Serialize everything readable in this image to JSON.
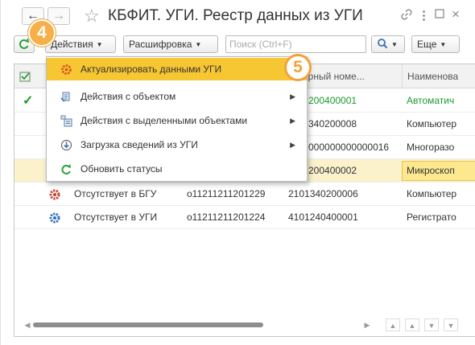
{
  "window": {
    "title": "КБФИТ. УГИ. Реестр данных из УГИ",
    "back_icon": "arrow-left-icon",
    "forward_icon": "arrow-right-icon",
    "favorite_icon": "star-icon",
    "link_icon": "link-icon",
    "more_icon": "more-vertical-icon",
    "maximize_icon": "maximize-icon",
    "close_icon": "close-icon"
  },
  "toolbar": {
    "refresh_icon": "refresh-icon",
    "actions_label": "Действия",
    "decode_label": "Расшифровка",
    "search_placeholder": "Поиск (Ctrl+F)",
    "search_icon": "magnifier-icon",
    "more_label": "Еще"
  },
  "table": {
    "headers": [
      "",
      "",
      "",
      "",
      "нтарный номе...",
      "Наименова"
    ],
    "rows": [
      {
        "status_icon": "check-icon",
        "col3": "",
        "col4": "",
        "inventory": "200400001",
        "name": "Автоматич",
        "green": true,
        "selected": false
      },
      {
        "status_icon": "",
        "col3": "",
        "col4": "",
        "inventory": "340200008",
        "name": "Компьютер",
        "green": false,
        "selected": false
      },
      {
        "status_icon": "",
        "col3": "",
        "col4": "",
        "inventory": "000000000000016",
        "name": "Многоразо",
        "green": false,
        "selected": false
      },
      {
        "status_icon": "",
        "col3": "",
        "col4": "",
        "inventory": "200400002",
        "name": "Микроскоп",
        "green": false,
        "selected": true
      },
      {
        "status_icon": "gear-red-icon",
        "col3": "Отсутствует в БГУ",
        "col4": "о11211211201229",
        "inventory": "2101340200006",
        "name": "Компьютер",
        "green": false,
        "selected": false
      },
      {
        "status_icon": "gear-blue-icon",
        "col3": "Отсутствует в УГИ",
        "col4": "о11211211201224",
        "inventory": "4101240400001",
        "name": "Регистрато",
        "green": false,
        "selected": false
      }
    ]
  },
  "menu": {
    "items": [
      {
        "label": "Актуализировать данными УГИ",
        "icon": "update-icon",
        "submenu": false,
        "active": true
      },
      {
        "label": "Действия с объектом",
        "icon": "object-actions-icon",
        "submenu": true,
        "active": false
      },
      {
        "label": "Действия с выделенными объектами",
        "icon": "selected-objects-icon",
        "submenu": true,
        "active": false
      },
      {
        "label": "Загрузка сведений из УГИ",
        "icon": "download-icon",
        "submenu": true,
        "active": false
      },
      {
        "label": "Обновить статусы",
        "icon": "refresh-icon",
        "submenu": false,
        "active": false
      }
    ]
  },
  "annotations": {
    "step4": "4",
    "step5": "5"
  },
  "colors": {
    "accent_yellow": "#f7c633",
    "selected_row": "#fbf2cc",
    "green_text": "#1c9a2a",
    "badge_orange": "#f2a23a"
  }
}
